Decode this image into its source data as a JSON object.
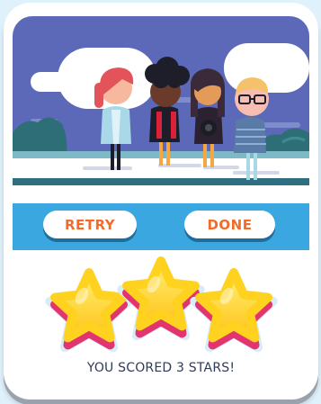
{
  "buttons": {
    "retry_label": "RETRY",
    "done_label": "DONE"
  },
  "result": {
    "stars_earned": 3,
    "stars_total": 3,
    "message": "YOU SCORED 3 STARS!"
  },
  "colors": {
    "button_text": "#f26b2a",
    "bar": "#3aa7e0",
    "star_gold": "#ffd21f",
    "star_pink": "#e2356f",
    "sky": "#5b69b8"
  }
}
